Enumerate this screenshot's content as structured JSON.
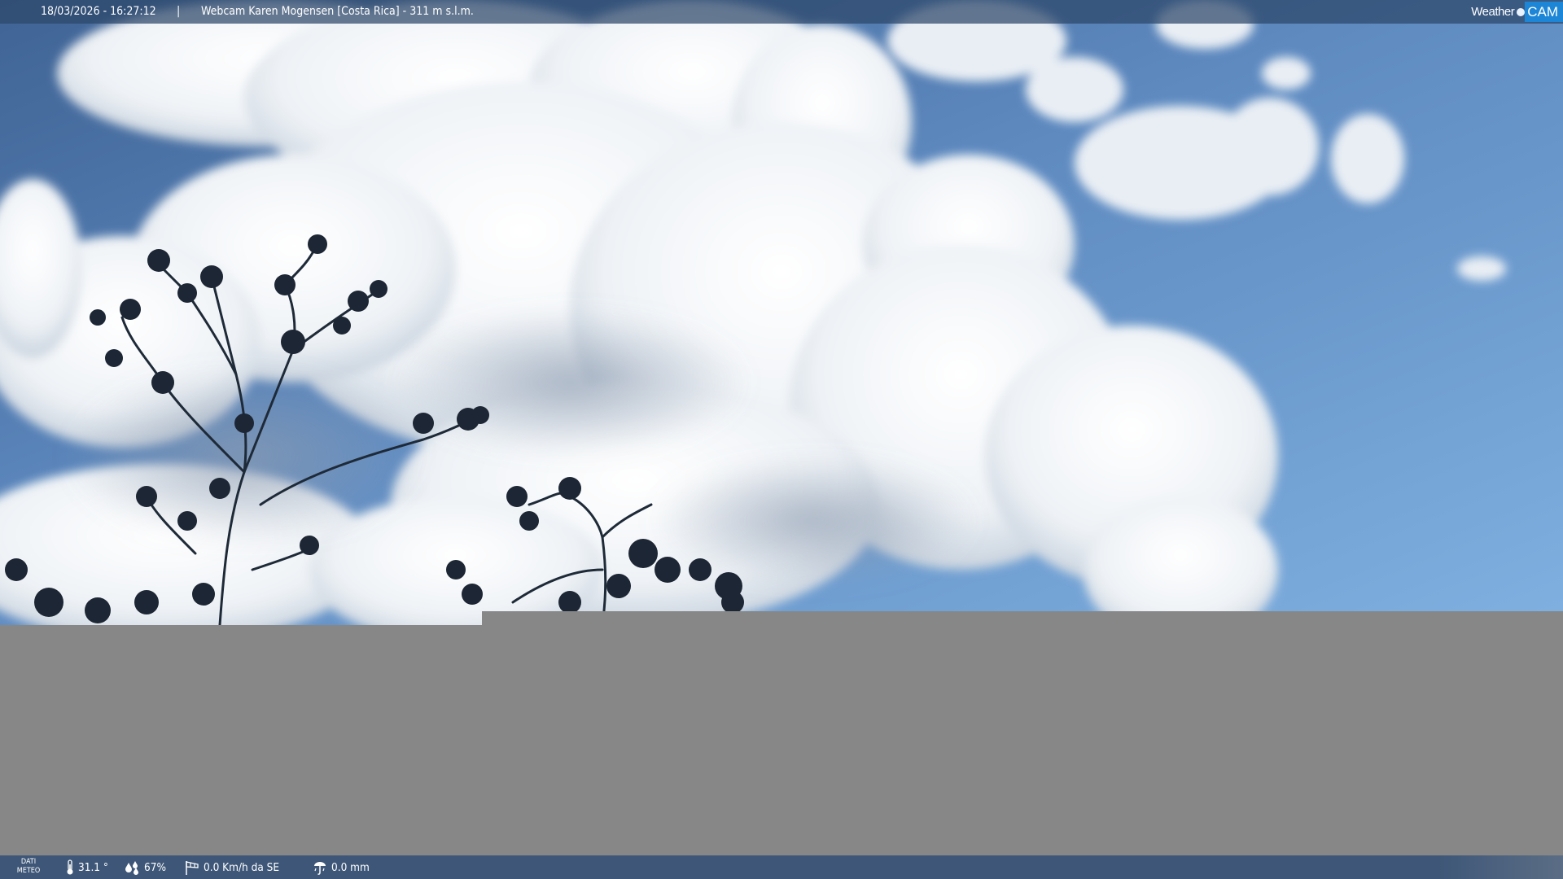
{
  "header": {
    "timestamp": "18/03/2026 - 16:27:12",
    "separator": "|",
    "title": "Webcam Karen Mogensen [Costa Rica]  - 311 m s.l.m.",
    "brand_word": "Weather",
    "brand_cam": "CAM"
  },
  "footer": {
    "dati_line1": "DATI",
    "dati_line2": "METEO",
    "temperature": "31.1 °",
    "humidity": "67%",
    "wind": "0.0 Km/h da SE",
    "rain": "0.0 mm"
  },
  "icons": {
    "temperature": "thermometer-icon",
    "humidity": "humidity-drops-icon",
    "wind": "windsock-icon",
    "rain": "rain-gauge-icon"
  },
  "colors": {
    "sky_top": "#4e76a8",
    "sky_bottom": "#7ea8d6",
    "missing_area": "#878787",
    "bar": "#3e5778",
    "brand_cam": "#1d86d6"
  }
}
